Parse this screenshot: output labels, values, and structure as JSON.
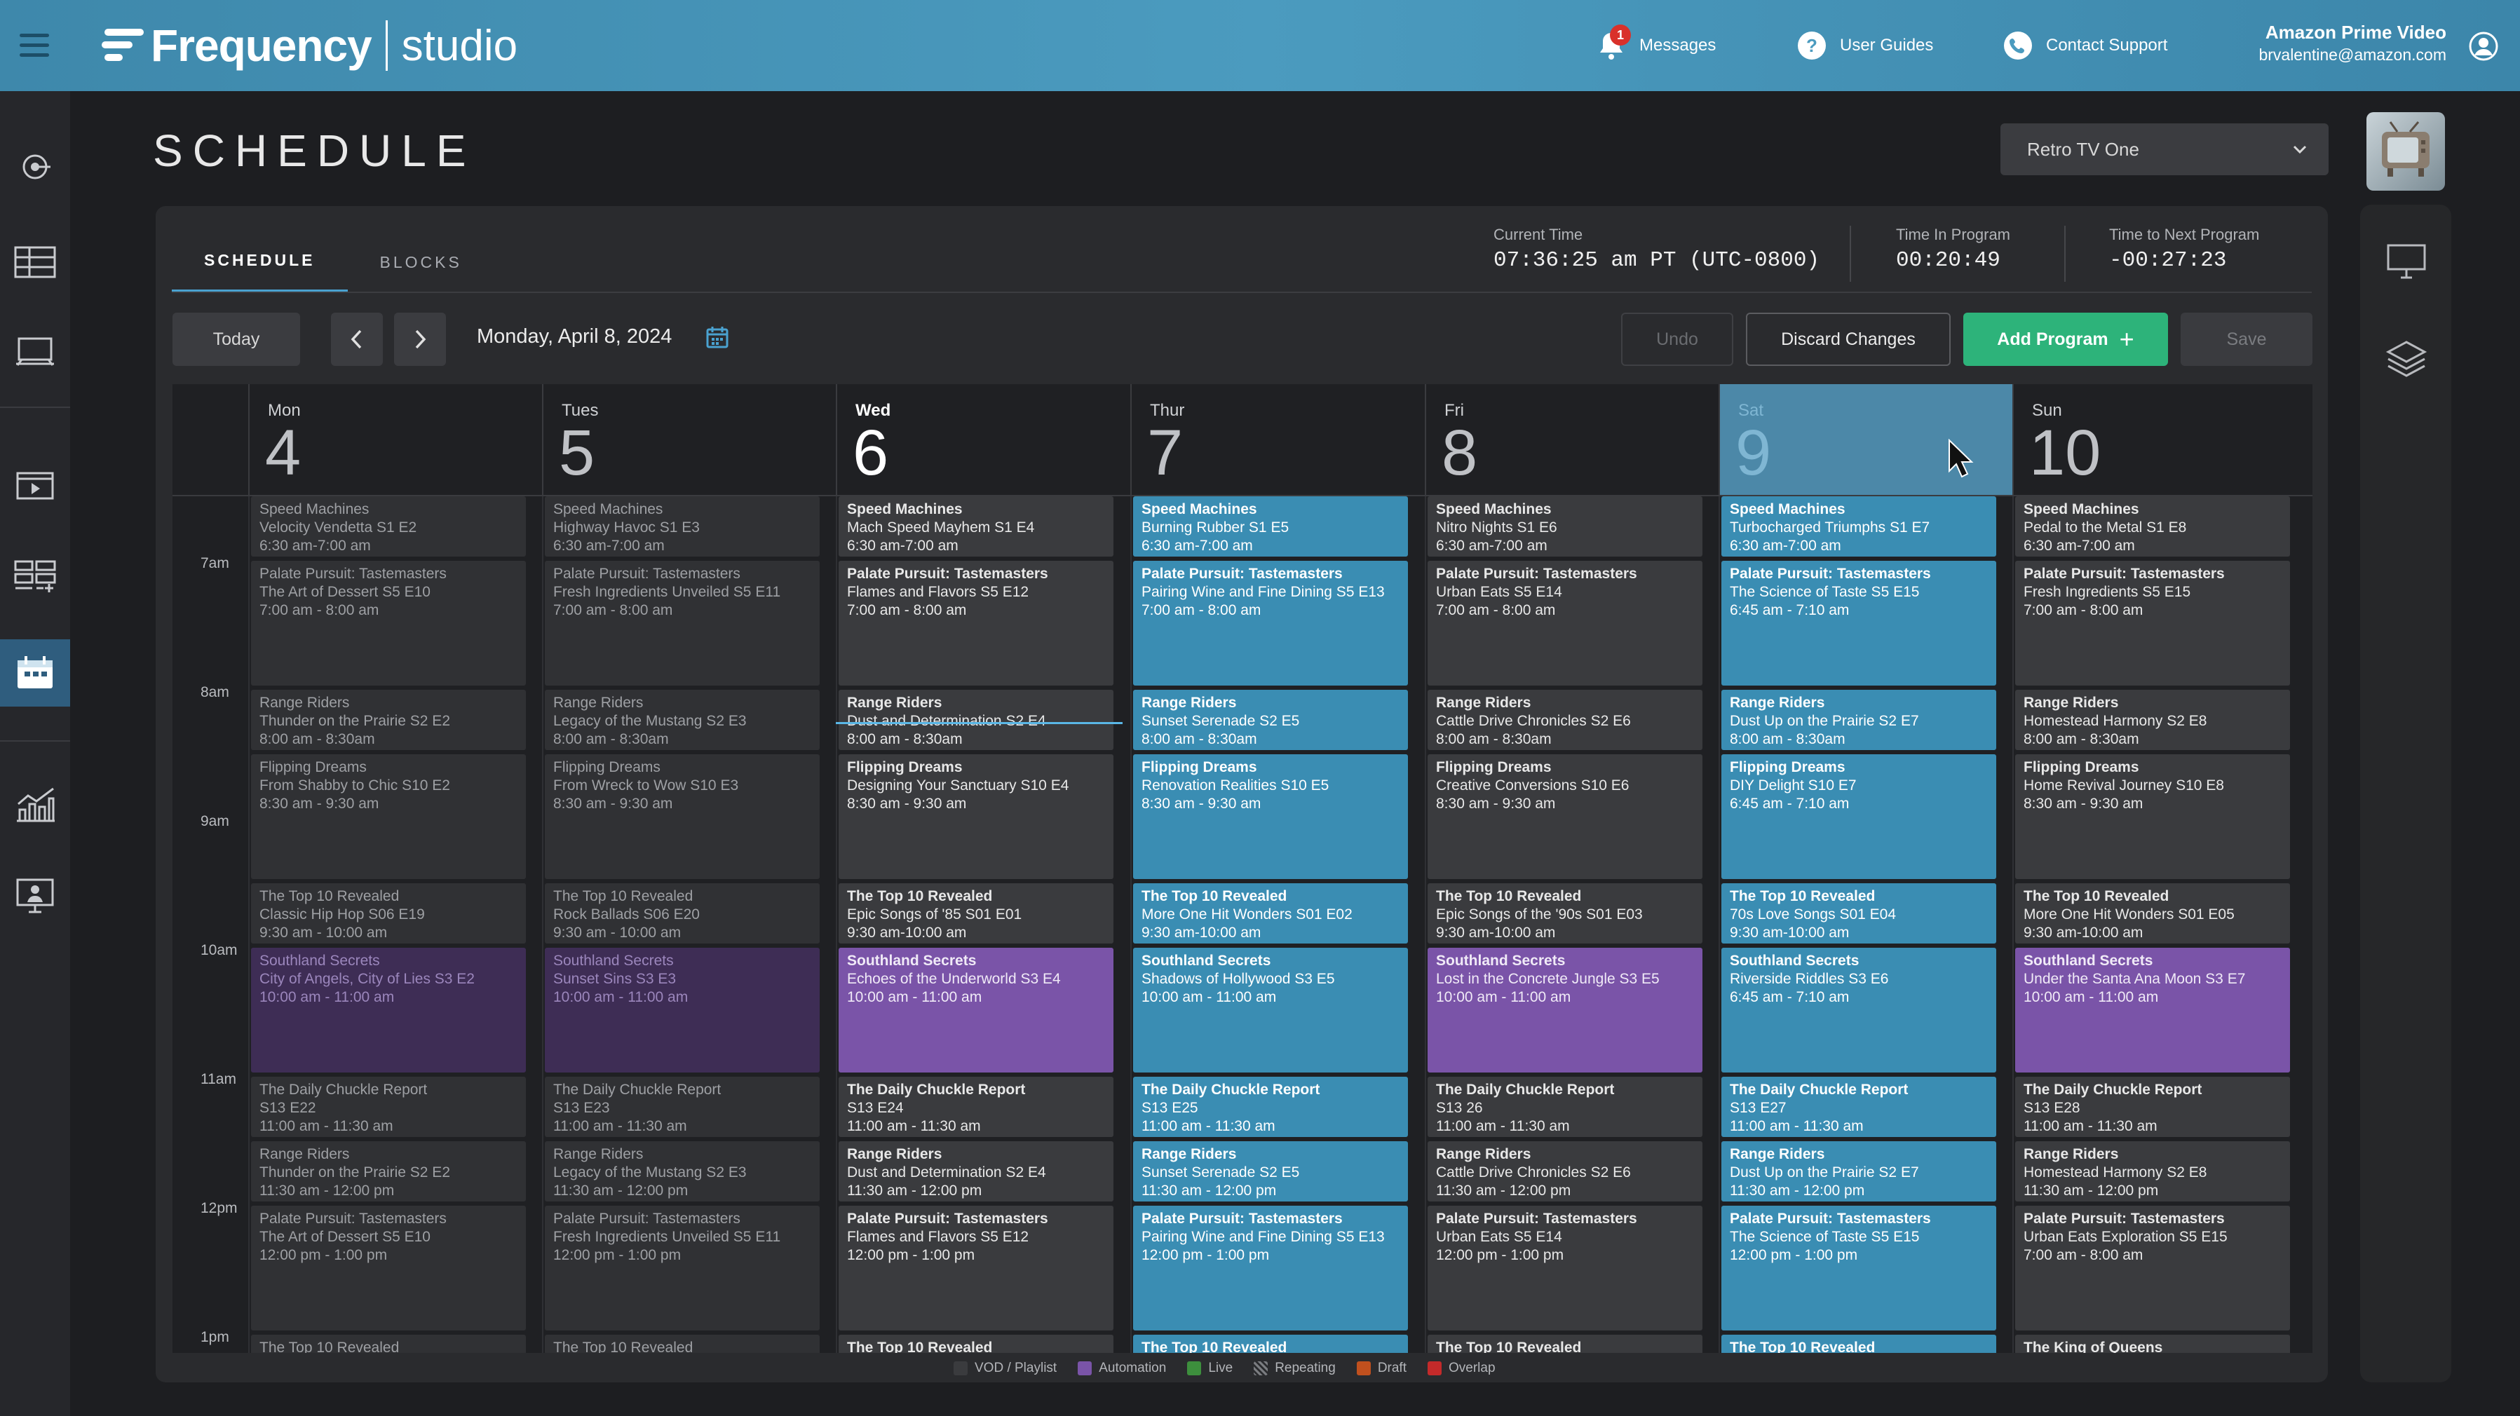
{
  "topbar": {
    "brand": "Frequency",
    "product": "studio",
    "nav": [
      {
        "label": "Messages",
        "icon": "bell-icon",
        "badge": "1"
      },
      {
        "label": "User Guides",
        "icon": "help-icon"
      },
      {
        "label": "Contact Support",
        "icon": "phone-icon"
      }
    ],
    "account_name": "Amazon Prime Video",
    "account_email": "brvalentine@amazon.com"
  },
  "page": {
    "title": "SCHEDULE",
    "channel": "Retro TV One"
  },
  "tabs": [
    {
      "label": "SCHEDULE",
      "active": true
    },
    {
      "label": "BLOCKS",
      "active": false
    }
  ],
  "status": {
    "current_time_label": "Current Time",
    "current_time": "07:36:25 am PT (UTC-0800)",
    "time_in_program_label": "Time In Program",
    "time_in_program": "00:20:49",
    "time_to_next_label": "Time to Next Program",
    "time_to_next": "-00:27:23"
  },
  "toolbar": {
    "today": "Today",
    "date": "Monday, April 8, 2024",
    "undo": "Undo",
    "discard": "Discard Changes",
    "add": "Add Program",
    "add_icon": "+",
    "save": "Save"
  },
  "days": [
    {
      "name": "Mon",
      "num": "4"
    },
    {
      "name": "Tues",
      "num": "5"
    },
    {
      "name": "Wed",
      "num": "6"
    },
    {
      "name": "Thur",
      "num": "7"
    },
    {
      "name": "Fri",
      "num": "8"
    },
    {
      "name": "Sat",
      "num": "9"
    },
    {
      "name": "Sun",
      "num": "10"
    }
  ],
  "hours": [
    "7am",
    "8am",
    "9am",
    "10am",
    "11am",
    "12pm",
    "1pm"
  ],
  "columns": [
    [
      {
        "t": "Speed Machines",
        "s": "Velocity Vendetta S1 E2",
        "tm": "6:30 am-7:00 am"
      },
      {
        "t": "Palate Pursuit: Tastemasters",
        "s": "The Art of Dessert S5 E10",
        "tm": "7:00 am - 8:00 am"
      },
      {
        "t": "Range Riders",
        "s": "Thunder on the Prairie S2 E2",
        "tm": "8:00 am - 8:30am"
      },
      {
        "t": "Flipping Dreams",
        "s": "From Shabby to Chic S10 E2",
        "tm": "8:30 am - 9:30 am"
      },
      {
        "t": "The Top 10 Revealed",
        "s": "Classic Hip Hop S06 E19",
        "tm": "9:30 am - 10:00 am"
      },
      {
        "t": "Southland Secrets",
        "s": "City of Angels, City of Lies S3 E2",
        "tm": "10:00 am - 11:00 am"
      },
      {
        "t": "The Daily Chuckle Report",
        "s": "S13 E22",
        "tm": "11:00 am - 11:30 am"
      },
      {
        "t": "Range Riders",
        "s": "Thunder on the Prairie S2 E2",
        "tm": "11:30 am - 12:00 pm"
      },
      {
        "t": "Palate Pursuit: Tastemasters",
        "s": "The Art of Dessert S5 E10",
        "tm": "12:00 pm - 1:00 pm"
      },
      {
        "t": "The Top 10 Revealed",
        "s": "",
        "tm": ""
      }
    ],
    [
      {
        "t": "Speed Machines",
        "s": "Highway Havoc S1 E3",
        "tm": "6:30 am-7:00 am"
      },
      {
        "t": "Palate Pursuit: Tastemasters",
        "s": "Fresh Ingredients Unveiled S5 E11",
        "tm": "7:00 am - 8:00 am"
      },
      {
        "t": "Range Riders",
        "s": "Legacy of the Mustang S2 E3",
        "tm": "8:00 am - 8:30am"
      },
      {
        "t": "Flipping Dreams",
        "s": "From Wreck to Wow S10 E3",
        "tm": "8:30 am - 9:30 am"
      },
      {
        "t": "The Top 10 Revealed",
        "s": "Rock Ballads S06 E20",
        "tm": "9:30 am - 10:00 am"
      },
      {
        "t": "Southland Secrets",
        "s": "Sunset Sins S3 E3",
        "tm": "10:00 am - 11:00 am"
      },
      {
        "t": "The Daily Chuckle Report",
        "s": "S13 E23",
        "tm": "11:00 am - 11:30 am"
      },
      {
        "t": "Range Riders",
        "s": "Legacy of the Mustang S2 E3",
        "tm": "11:30 am - 12:00 pm"
      },
      {
        "t": "Palate Pursuit: Tastemasters",
        "s": "Fresh Ingredients Unveiled S5 E11",
        "tm": "12:00 pm - 1:00 pm"
      },
      {
        "t": "The Top 10 Revealed",
        "s": "",
        "tm": ""
      }
    ],
    [
      {
        "t": "Speed Machines",
        "s": "Mach Speed Mayhem S1 E4",
        "tm": "6:30 am-7:00 am"
      },
      {
        "t": "Palate Pursuit: Tastemasters",
        "s": "Flames and Flavors S5 E12",
        "tm": "7:00 am - 8:00 am"
      },
      {
        "t": "Range Riders",
        "s": "Dust and Determination S2 E4",
        "tm": "8:00 am - 8:30am"
      },
      {
        "t": "Flipping Dreams",
        "s": "Designing Your Sanctuary S10 E4",
        "tm": "8:30 am - 9:30 am"
      },
      {
        "t": "The Top 10 Revealed",
        "s": "Epic Songs of '85 S01 E01",
        "tm": "9:30 am-10:00 am"
      },
      {
        "t": "Southland Secrets",
        "s": "Echoes of the Underworld S3 E4",
        "tm": "10:00 am - 11:00 am"
      },
      {
        "t": "The Daily Chuckle Report",
        "s": "S13 E24",
        "tm": "11:00 am - 11:30 am"
      },
      {
        "t": "Range Riders",
        "s": "Dust and Determination S2 E4",
        "tm": "11:30 am - 12:00 pm"
      },
      {
        "t": "Palate Pursuit: Tastemasters",
        "s": "Flames and Flavors S5 E12",
        "tm": "12:00 pm - 1:00 pm"
      },
      {
        "t": "The Top 10 Revealed",
        "s": "",
        "tm": ""
      }
    ],
    [
      {
        "t": "Speed Machines",
        "s": "Burning Rubber S1 E5",
        "tm": "6:30 am-7:00 am"
      },
      {
        "t": "Palate Pursuit: Tastemasters",
        "s": "Pairing Wine and Fine Dining S5 E13",
        "tm": "7:00 am - 8:00 am"
      },
      {
        "t": "Range Riders",
        "s": "Sunset Serenade S2 E5",
        "tm": "8:00 am - 8:30am"
      },
      {
        "t": "Flipping Dreams",
        "s": "Renovation Realities S10 E5",
        "tm": "8:30 am - 9:30 am"
      },
      {
        "t": "The Top 10 Revealed",
        "s": "More One Hit Wonders S01 E02",
        "tm": "9:30 am-10:00 am"
      },
      {
        "t": "Southland Secrets",
        "s": "Shadows of Hollywood S3 E5",
        "tm": "10:00 am - 11:00 am"
      },
      {
        "t": "The Daily Chuckle Report",
        "s": "S13 E25",
        "tm": "11:00 am - 11:30 am"
      },
      {
        "t": "Range Riders",
        "s": "Sunset Serenade S2 E5",
        "tm": "11:30 am - 12:00 pm"
      },
      {
        "t": "Palate Pursuit: Tastemasters",
        "s": "Pairing Wine and Fine Dining S5 E13",
        "tm": "12:00 pm - 1:00 pm"
      },
      {
        "t": "The Top 10 Revealed",
        "s": "",
        "tm": ""
      }
    ],
    [
      {
        "t": "Speed Machines",
        "s": "Nitro Nights S1 E6",
        "tm": "6:30 am-7:00 am"
      },
      {
        "t": "Palate Pursuit: Tastemasters",
        "s": "Urban Eats S5 E14",
        "tm": "7:00 am - 8:00 am"
      },
      {
        "t": "Range Riders",
        "s": "Cattle Drive Chronicles S2 E6",
        "tm": "8:00 am - 8:30am"
      },
      {
        "t": "Flipping Dreams",
        "s": "Creative Conversions S10 E6",
        "tm": "8:30 am - 9:30 am"
      },
      {
        "t": "The Top 10 Revealed",
        "s": "Epic Songs of the '90s S01 E03",
        "tm": "9:30 am-10:00 am"
      },
      {
        "t": "Southland Secrets",
        "s": "Lost in the Concrete Jungle S3 E5",
        "tm": "10:00 am - 11:00 am"
      },
      {
        "t": "The Daily Chuckle Report",
        "s": "S13 26",
        "tm": "11:00 am - 11:30 am"
      },
      {
        "t": "Range Riders",
        "s": "Cattle Drive Chronicles S2 E6",
        "tm": "11:30 am - 12:00 pm"
      },
      {
        "t": "Palate Pursuit: Tastemasters",
        "s": "Urban Eats S5 E14",
        "tm": "12:00 pm - 1:00 pm"
      },
      {
        "t": "The Top 10 Revealed",
        "s": "",
        "tm": ""
      }
    ],
    [
      {
        "t": "Speed Machines",
        "s": "Turbocharged Triumphs S1 E7",
        "tm": "6:30 am-7:00 am"
      },
      {
        "t": "Palate Pursuit: Tastemasters",
        "s": "The Science of Taste S5 E15",
        "tm": "6:45 am - 7:10 am"
      },
      {
        "t": "Range Riders",
        "s": "Dust Up on the Prairie S2 E7",
        "tm": "8:00 am - 8:30am"
      },
      {
        "t": "Flipping Dreams",
        "s": "DIY Delight S10 E7",
        "tm": "6:45 am - 7:10 am"
      },
      {
        "t": "The Top 10 Revealed",
        "s": "70s Love Songs S01 E04",
        "tm": "9:30 am-10:00 am"
      },
      {
        "t": "Southland Secrets",
        "s": "Riverside Riddles S3 E6",
        "tm": "6:45 am - 7:10 am"
      },
      {
        "t": "The Daily Chuckle Report",
        "s": "S13 E27",
        "tm": "11:00 am - 11:30 am"
      },
      {
        "t": "Range Riders",
        "s": "Dust Up on the Prairie S2 E7",
        "tm": "11:30 am - 12:00 pm"
      },
      {
        "t": "Palate Pursuit: Tastemasters",
        "s": "The Science of Taste S5 E15",
        "tm": "12:00 pm - 1:00 pm"
      },
      {
        "t": "The Top 10 Revealed",
        "s": "",
        "tm": ""
      }
    ],
    [
      {
        "t": "Speed Machines",
        "s": "Pedal to the Metal S1 E8",
        "tm": "6:30 am-7:00 am"
      },
      {
        "t": "Palate Pursuit: Tastemasters",
        "s": "Fresh Ingredients S5 E15",
        "tm": "7:00 am - 8:00 am"
      },
      {
        "t": "Range Riders",
        "s": "Homestead Harmony S2 E8",
        "tm": "8:00 am - 8:30am"
      },
      {
        "t": "Flipping Dreams",
        "s": "Home Revival Journey S10 E8",
        "tm": "8:30 am - 9:30 am"
      },
      {
        "t": "The Top 10 Revealed",
        "s": " More One Hit Wonders S01 E05",
        "tm": "9:30 am-10:00 am"
      },
      {
        "t": "Southland Secrets",
        "s": "Under the Santa Ana Moon S3 E7",
        "tm": "10:00 am - 11:00 am"
      },
      {
        "t": "The Daily Chuckle Report",
        "s": "S13 E28",
        "tm": "11:00 am - 11:30 am"
      },
      {
        "t": "Range Riders",
        "s": "Homestead Harmony S2 E8",
        "tm": "11:30 am - 12:00 pm"
      },
      {
        "t": "Palate Pursuit: Tastemasters",
        "s": "Urban Eats Exploration S5 E15",
        "tm": "7:00 am - 8:00 am"
      },
      {
        "t": "The King of Queens",
        "s": "",
        "tm": ""
      }
    ]
  ],
  "legend": [
    {
      "label": "VOD / Playlist",
      "color": "#3a3b3e"
    },
    {
      "label": "Automation",
      "color": "#7a54a8"
    },
    {
      "label": "Live",
      "color": "#3d8f3d"
    },
    {
      "label": "Repeating",
      "color": "#555a5f"
    },
    {
      "label": "Draft",
      "color": "#c0501e"
    },
    {
      "label": "Overlap",
      "color": "#c42a2a"
    }
  ],
  "colors": {
    "topbar": "#4b9bbf",
    "accent_green": "#2db37a",
    "live_blue": "#3a8db3",
    "automation_purple": "#7a54a8"
  }
}
